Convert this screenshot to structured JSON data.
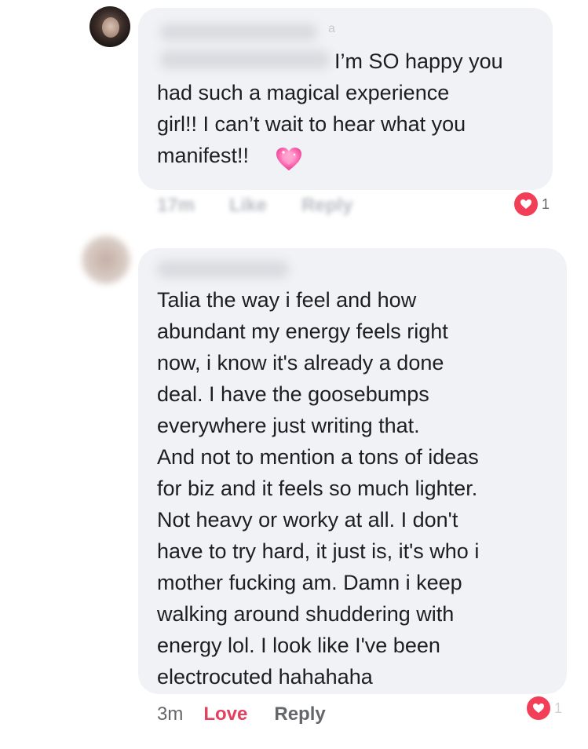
{
  "comments": [
    {
      "author": "",
      "text_first_line": "I’m SO happy you",
      "text_rest": "had such a magical experience\ngirl!! I can’t wait to hear what you\nmanifest!!",
      "emoji": "pink-sparkling-heart",
      "timestamp": "17m",
      "like_label": "Like",
      "reply_label": "Reply",
      "reaction": "love",
      "reaction_count": "1"
    },
    {
      "author": "",
      "text": "Talia the way i feel and how\nabundant my energy feels right\nnow, i know it's already a done\ndeal. I have the goosebumps\neverywhere just writing that.\nAnd not to mention a tons of ideas\nfor biz and it feels so much lighter.\nNot heavy or worky at all.  I don't\nhave to try hard, it just is, it's who i\nmother fucking am. Damn i keep\nwalking around shuddering with\nenergy lol. I look like I've been\nelectrocuted hahahaha",
      "timestamp": "3m",
      "love_label": "Love",
      "reply_label": "Reply",
      "reaction": "love",
      "reaction_count": "1"
    }
  ],
  "colors": {
    "bubble": "#f0f2f5",
    "text": "#1c1e21",
    "love_accent": "#e4405f",
    "meta": "#65676b",
    "reaction": "#f33e58"
  }
}
